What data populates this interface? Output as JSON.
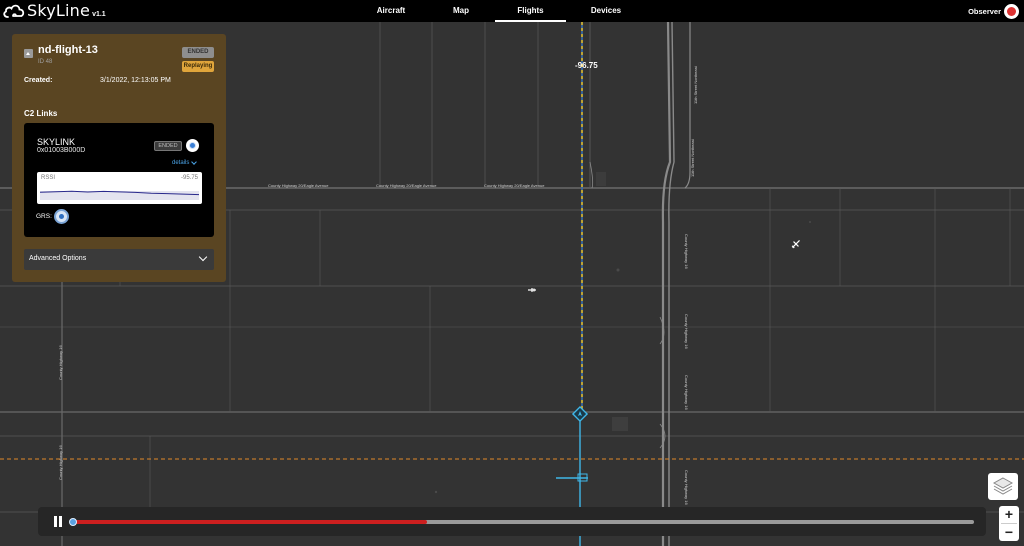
{
  "app": {
    "name": "SkyLine",
    "version": "v1.1",
    "brand_color": "#000000"
  },
  "nav": {
    "tabs": [
      {
        "label": "Aircraft"
      },
      {
        "label": "Map"
      },
      {
        "label": "Flights",
        "active": true
      },
      {
        "label": "Devices"
      }
    ]
  },
  "user": {
    "role": "Observer",
    "avatar_icon": "avatar-icon"
  },
  "flight": {
    "name": "nd-flight-13",
    "id_text": "ID 48",
    "status": "ENDED",
    "mode": "Replaying",
    "created_label": "Created:",
    "created_value": "3/1/2022, 12:13:05 PM",
    "panel_color": "#5a4522",
    "replay_color": "#e0a53b"
  },
  "c2": {
    "heading": "C2 Links",
    "link": {
      "name": "SKYLINK",
      "id": "0x01003B000D",
      "status": "ENDED",
      "details_label": "details",
      "rssi_label": "RSSI",
      "rssi_value": "-95.75",
      "rssi_samples": [
        -94.2,
        -93.8,
        -93.5,
        -94.0,
        -93.6,
        -93.9,
        -94.3,
        -94.8,
        -95.1,
        -95.4,
        -95.75
      ],
      "grs_label": "GRS:"
    }
  },
  "advanced": {
    "label": "Advanced Options"
  },
  "map": {
    "heading_value": "-96.75",
    "road_labels": [
      "County Highway 20/Eagle Avenue",
      "County Highway 20/Eagle Avenue",
      "County Highway 20/Eagle Avenue",
      "11th Street Northeast",
      "11th Street Northeast",
      "County Highway 16",
      "County Highway 16",
      "County Highway 16",
      "County Highway 16",
      "County Highway 16",
      "County Highway 16"
    ],
    "track_color": "#f5c518",
    "boundary_color": "#e08a2a",
    "drone_color": "#3fb7e8"
  },
  "controls": {
    "zoom_in": "+",
    "zoom_out": "−"
  },
  "playback": {
    "progress_fraction": 0.394,
    "progress_color": "#cc1f1f"
  }
}
